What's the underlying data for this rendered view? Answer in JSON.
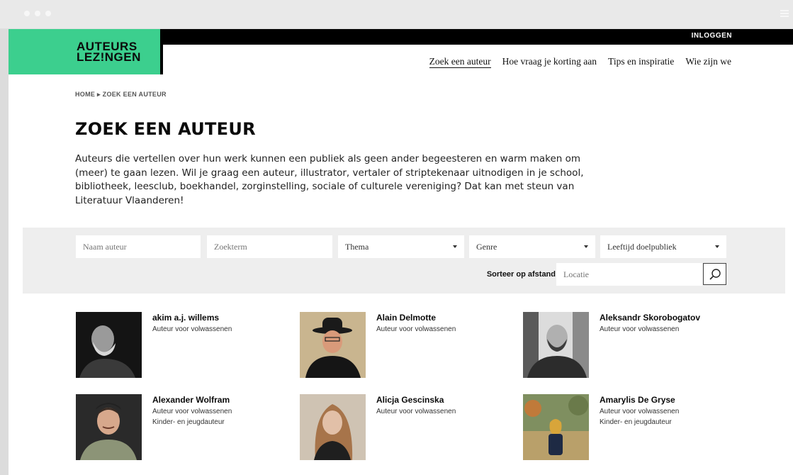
{
  "site": {
    "logo_line1": "AUTEURS",
    "logo_line2": "LEZ!NGEN",
    "login": "INLOGGEN",
    "brand_color": "#3ccf8e"
  },
  "nav": {
    "items": [
      {
        "label": "Zoek een auteur"
      },
      {
        "label": "Hoe vraag je korting aan"
      },
      {
        "label": "Tips en inspiratie"
      },
      {
        "label": "Wie zijn we"
      }
    ]
  },
  "breadcrumb": {
    "home": "HOME",
    "separator": "▸",
    "current": "ZOEK EEN AUTEUR"
  },
  "page": {
    "title": "ZOEK EEN AUTEUR",
    "intro": "Auteurs die vertellen over hun werk kunnen een publiek als geen ander begeesteren en warm maken om (meer) te gaan lezen. Wil je graag een auteur, illustrator, vertaler of striptekenaar uitnodigen in je school, bibliotheek, leesclub, boekhandel, zorginstelling, sociale of culturele vereniging? Dat kan met steun van Literatuur Vlaanderen!"
  },
  "filters": {
    "name_placeholder": "Naam auteur",
    "term_placeholder": "Zoekterm",
    "theme": "Thema",
    "genre": "Genre",
    "age": "Leeftijd doelpubliek",
    "sort_label": "Sorteer op afstand",
    "location_placeholder": "Locatie",
    "search_icon": "search-icon"
  },
  "authors": [
    {
      "name": "akim a.j. willems",
      "roles": [
        "Auteur voor volwassenen"
      ]
    },
    {
      "name": "Alain Delmotte",
      "roles": [
        "Auteur voor volwassenen"
      ]
    },
    {
      "name": "Aleksandr Skorobogatov",
      "roles": [
        "Auteur voor volwassenen"
      ]
    },
    {
      "name": "Alexander Wolfram",
      "roles": [
        "Auteur voor volwassenen",
        "Kinder- en jeugdauteur"
      ]
    },
    {
      "name": "Alicja Gescinska",
      "roles": [
        "Auteur voor volwassenen"
      ]
    },
    {
      "name": "Amarylis De Gryse",
      "roles": [
        "Auteur voor volwassenen",
        "Kinder- en jeugdauteur"
      ]
    }
  ]
}
